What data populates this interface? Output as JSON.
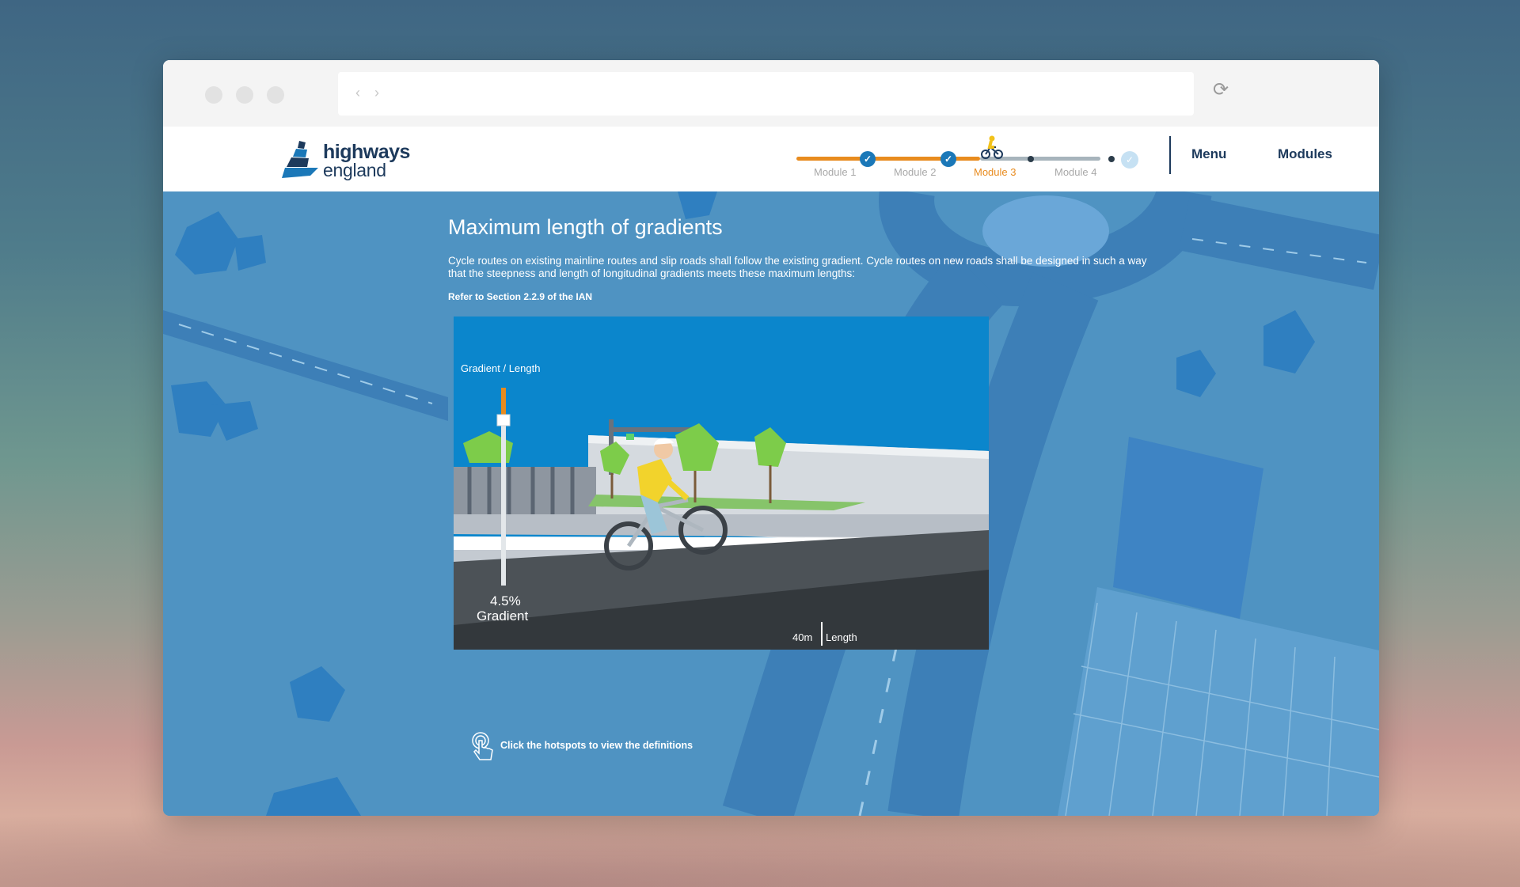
{
  "header": {
    "logo": {
      "line1": "highways",
      "line2": "england"
    },
    "progress": {
      "modules": [
        {
          "label": "Module 1",
          "state": "complete"
        },
        {
          "label": "Module 2",
          "state": "complete"
        },
        {
          "label": "Module 3",
          "state": "current"
        },
        {
          "label": "Module 4",
          "state": "upcoming"
        }
      ],
      "colors": {
        "done": "#e88b1e",
        "node": "#1b78b8",
        "pending": "#a7b4bc"
      }
    },
    "menu_label": "Menu",
    "modules_label": "Modules"
  },
  "main": {
    "title": "Maximum length of gradients",
    "intro": "Cycle routes on existing mainline routes and slip roads shall follow the existing gradient. Cycle routes on new roads shall be designed in such a way that the steepness and length of longitudinal gradients meets these maximum lengths:",
    "reference": "Refer to Section 2.2.9 of the IAN",
    "media": {
      "gauge_title": "Gradient / Length",
      "gradient_value": "4.5%",
      "gradient_label": "Gradient",
      "length_value": "40m",
      "length_label": "Length",
      "gradient_fraction": 0.18
    },
    "hint": "Click the hotspots to view the definitions"
  }
}
